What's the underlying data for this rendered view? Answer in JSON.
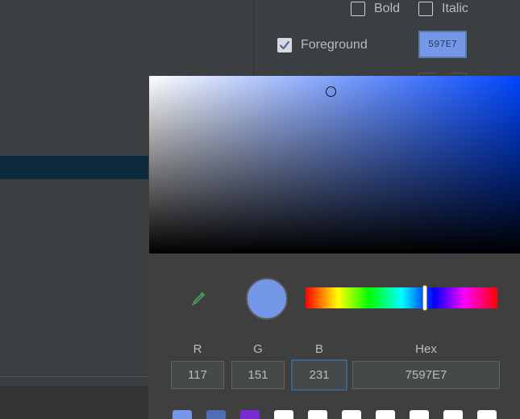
{
  "options": {
    "bold_label": "Bold",
    "italic_label": "Italic",
    "foreground_label": "Foreground",
    "foreground_checked": true,
    "bold_checked": false,
    "italic_checked": false,
    "foreground_hex": "597E7"
  },
  "picker": {
    "hue_fraction": 0.62,
    "saturation_fraction": 0.49,
    "brightness_fraction": 0.91,
    "preview_color": "#7597e7",
    "labels": {
      "r": "R",
      "g": "G",
      "b": "B",
      "hex": "Hex"
    },
    "values": {
      "r": "117",
      "g": "151",
      "b": "231",
      "hex": "7597E7"
    },
    "recent_colors": [
      "#7597e7",
      "#4f6db5",
      "#7a2ad1",
      "#ffffff",
      "#ffffff",
      "#ffffff",
      "#ffffff",
      "#ffffff",
      "#ffffff",
      "#ffffff"
    ]
  },
  "icons": {
    "eyedropper": "eyedropper-icon",
    "check": "check-icon"
  },
  "colors": {
    "background": "#3c3f41",
    "selection": "#0d293e",
    "focus_border": "#3d6185"
  }
}
